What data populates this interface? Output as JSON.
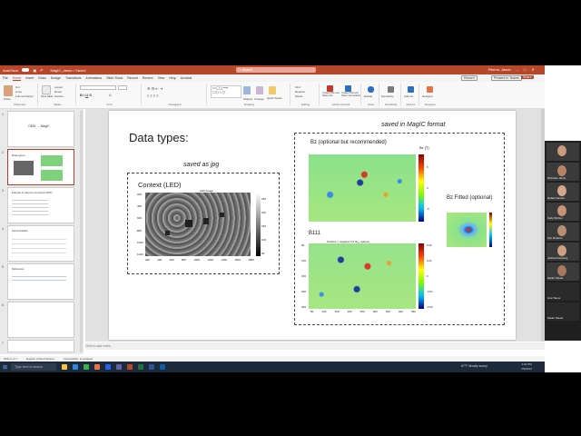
{
  "app": {
    "title_left": "AutoSave",
    "doc_title": "MagIC_demo • Saved",
    "search": "Search",
    "user": "Renne, Jason",
    "window_controls": [
      "–",
      "□",
      "✕"
    ]
  },
  "tabs": [
    "File",
    "Home",
    "Insert",
    "Draw",
    "Design",
    "Transitions",
    "Animations",
    "Slide Show",
    "Record",
    "Review",
    "View",
    "Help",
    "Acrobat"
  ],
  "tab_active": "Home",
  "tab_buttons": {
    "record": "Record",
    "present": "Present in Teams",
    "share": "Share"
  },
  "ribbon": {
    "groups": [
      "Clipboard",
      "Slides",
      "Font",
      "Paragraph",
      "Drawing",
      "Editing",
      "Adobe Acrobat",
      "Voice",
      "Sensitivity",
      "Add-ins",
      "Designer"
    ],
    "clipboard": [
      "Cut",
      "Copy",
      "Format Painter"
    ],
    "slides": [
      "New Slide",
      "Layout",
      "Reset",
      "Section"
    ],
    "editing": [
      "Find",
      "Replace",
      "Select"
    ],
    "acrobat": [
      "Create PDF and Share link",
      "Create PDF and Share via Outlook"
    ],
    "voice": "Dictate",
    "sensitivity": "Sensitivity",
    "addins": "Add-ins",
    "designer": "Designer",
    "paste": "Paste",
    "shapes": "Shapes",
    "arrange": "Arrange",
    "quick_styles": "Quick Styles"
  },
  "thumbnails": [
    {
      "num": "1",
      "text": "ODM → MagIC"
    },
    {
      "num": "2",
      "text": "Data types"
    },
    {
      "num": "3",
      "text": "Example of steps for conversion (PDF)"
    },
    {
      "num": "4",
      "text": "Instrumentation"
    },
    {
      "num": "5",
      "text": "References"
    },
    {
      "num": "6",
      "text": ""
    }
  ],
  "slide": {
    "title": "Data types:",
    "saved_jpg": "saved as jpg",
    "saved_magic": "saved in MagIC format",
    "context_label": "Context (LED)",
    "led_image_title": "LED Image",
    "bz_label": "Bz (optional but recommended)",
    "bz_colorbar_label": "Bz [T]",
    "bz_fitted_label": "Bz Fitted (optional)",
    "b111_label": "B111",
    "b111_title": "Positive = negative fmr B₁₁₁ (gauss)",
    "led_xticks": [
      "200",
      "400",
      "600",
      "800",
      "1000",
      "1200",
      "1400",
      "1600",
      "1800"
    ],
    "led_yticks": [
      "200",
      "400",
      "600",
      "800",
      "1000",
      "1200"
    ],
    "led_cbar_ticks": [
      "250",
      "200",
      "150",
      "100",
      "50"
    ],
    "bz_cbar_ticks": [
      "-5",
      "0",
      "5"
    ],
    "b111_cbar_ticks": [
      "0.02",
      "0.01",
      "0",
      "-0.01",
      "-0.02"
    ],
    "b111_xticks": [
      "50",
      "100",
      "150",
      "200",
      "250",
      "300",
      "350",
      "400",
      "450"
    ],
    "b111_yticks": [
      "50",
      "100",
      "150",
      "200",
      "250"
    ]
  },
  "notes_placeholder": "Click to add notes",
  "status": {
    "slide_of": "Slide 2 of 7",
    "lang": "English (United States)",
    "accessibility": "Accessibility: Investigate"
  },
  "taskbar": {
    "search": "Type here to search",
    "weather": "67°F Mostly sunny",
    "time": "4:01 PM",
    "date": "7/9/2024"
  },
  "participants": [
    {
      "name": ""
    },
    {
      "name": "Nicholas Jarvis"
    },
    {
      "name": "Rafael Santos"
    },
    {
      "name": "Kelly Richter"
    },
    {
      "name": "Kim Roberts"
    },
    {
      "name": "Joshua Feinberg"
    },
    {
      "name": "Sarah Steele"
    },
    {
      "name": "Lisa Tauxe"
    },
    {
      "name": "Sarah Steele"
    }
  ],
  "colors": {
    "accent": "#b7472a",
    "taskbar": "#1c2a3a"
  }
}
